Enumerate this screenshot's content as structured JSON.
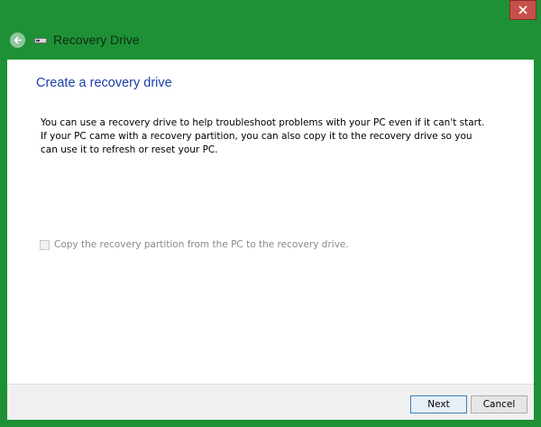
{
  "window": {
    "title": "Recovery Drive",
    "frame_color": "#1e9136",
    "close_button_color": "#c7504b"
  },
  "icons": {
    "back": "back-arrow-icon",
    "drive": "usb-drive-icon",
    "close": "close-icon"
  },
  "main": {
    "heading": "Create a recovery drive",
    "description": "You can use a recovery drive to help troubleshoot problems with your PC even if it can't start. If your PC came with a recovery partition, you can also copy it to the recovery drive so you can use it to refresh or reset your PC.",
    "checkbox": {
      "label": "Copy the recovery partition from the PC to the recovery drive.",
      "checked": false,
      "enabled": false
    }
  },
  "footer": {
    "next_label": "Next",
    "cancel_label": "Cancel"
  }
}
